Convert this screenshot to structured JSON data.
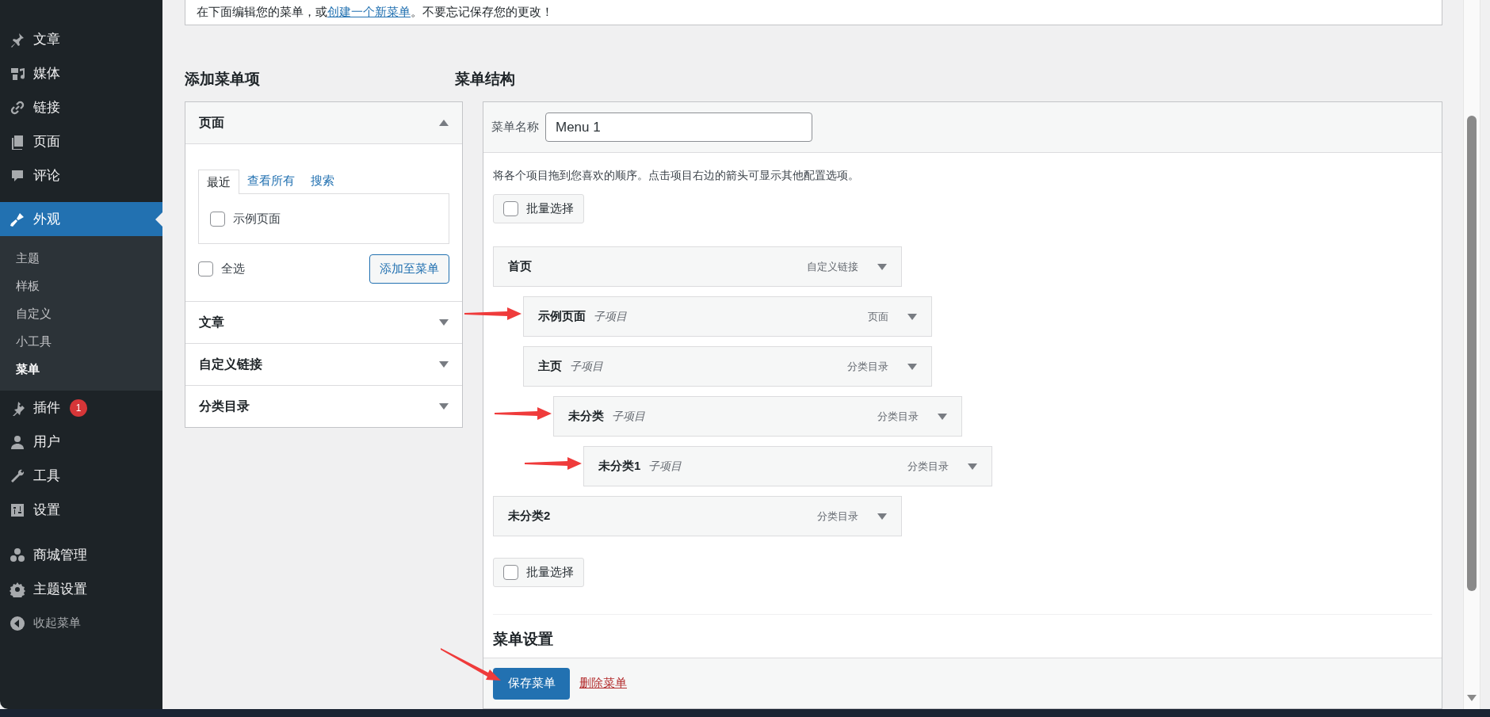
{
  "sidebar": {
    "groups": [
      [
        {
          "label": "文章",
          "selected": false
        },
        {
          "label": "媒体",
          "selected": false
        },
        {
          "label": "链接",
          "selected": false
        },
        {
          "label": "页面",
          "selected": false
        },
        {
          "label": "评论",
          "selected": false
        },
        {
          "label": "外观",
          "selected": true,
          "expanded": true,
          "children": [
            {
              "label": "主题",
              "selected": false
            },
            {
              "label": "样板",
              "selected": false
            },
            {
              "label": "自定义",
              "selected": false
            },
            {
              "label": "小工具",
              "selected": false
            },
            {
              "label": "菜单",
              "selected": true
            }
          ]
        },
        {
          "label": "插件",
          "selected": false,
          "badge": "1"
        },
        {
          "label": "用户",
          "selected": false
        },
        {
          "label": "工具",
          "selected": false
        },
        {
          "label": "设置",
          "selected": false
        }
      ],
      [
        {
          "label": "商城管理",
          "selected": false
        },
        {
          "label": "主题设置",
          "selected": false
        }
      ]
    ],
    "collapse_button": "收起菜单"
  },
  "notice": {
    "text_before": "在下面编辑您的菜单，或",
    "link": "创建一个新菜单",
    "text_after": "。不要忘记保存您的更改！"
  },
  "add_items": {
    "title": "添加菜单项",
    "sections": [
      {
        "title": "页面",
        "expanded": true,
        "tabs": [
          {
            "label": "最近",
            "selected": true
          },
          {
            "label": "查看所有",
            "selected": false
          },
          {
            "label": "搜索",
            "selected": false
          }
        ],
        "items": [
          {
            "label": "示例页面",
            "checked": false
          }
        ],
        "select_all": {
          "label": "全选",
          "checked": false
        },
        "add_button": "添加至菜单"
      },
      {
        "title": "文章",
        "expanded": false
      },
      {
        "title": "自定义链接",
        "expanded": false
      },
      {
        "title": "分类目录",
        "expanded": false
      }
    ]
  },
  "menu_structure": {
    "title": "菜单结构",
    "name_label": "菜单名称",
    "name_value": "Menu 1",
    "instructions": "将各个项目拖到您喜欢的顺序。点击项目右边的箭头可显示其他配置选项。",
    "bulk_select_top": {
      "label": "批量选择",
      "checked": false
    },
    "items": [
      {
        "title": "首页",
        "type": "自定义链接",
        "marked": false,
        "children": [
          {
            "title": "示例页面",
            "sub_label": "子项目",
            "type": "页面",
            "marked": true
          },
          {
            "title": "主页",
            "sub_label": "子项目",
            "type": "分类目录",
            "marked": false,
            "children": [
              {
                "title": "未分类",
                "sub_label": "子项目",
                "type": "分类目录",
                "marked": true,
                "children": [
                  {
                    "title": "未分类1",
                    "sub_label": "子项目",
                    "type": "分类目录",
                    "marked": true
                  }
                ]
              }
            ]
          }
        ]
      },
      {
        "title": "未分类2",
        "type": "分类目录",
        "marked": false
      }
    ],
    "bulk_select_bottom": {
      "label": "批量选择",
      "checked": false
    },
    "settings_title": "菜单设置",
    "save_button": {
      "label": "保存菜单",
      "marked": true
    },
    "delete_link": "删除菜单"
  }
}
